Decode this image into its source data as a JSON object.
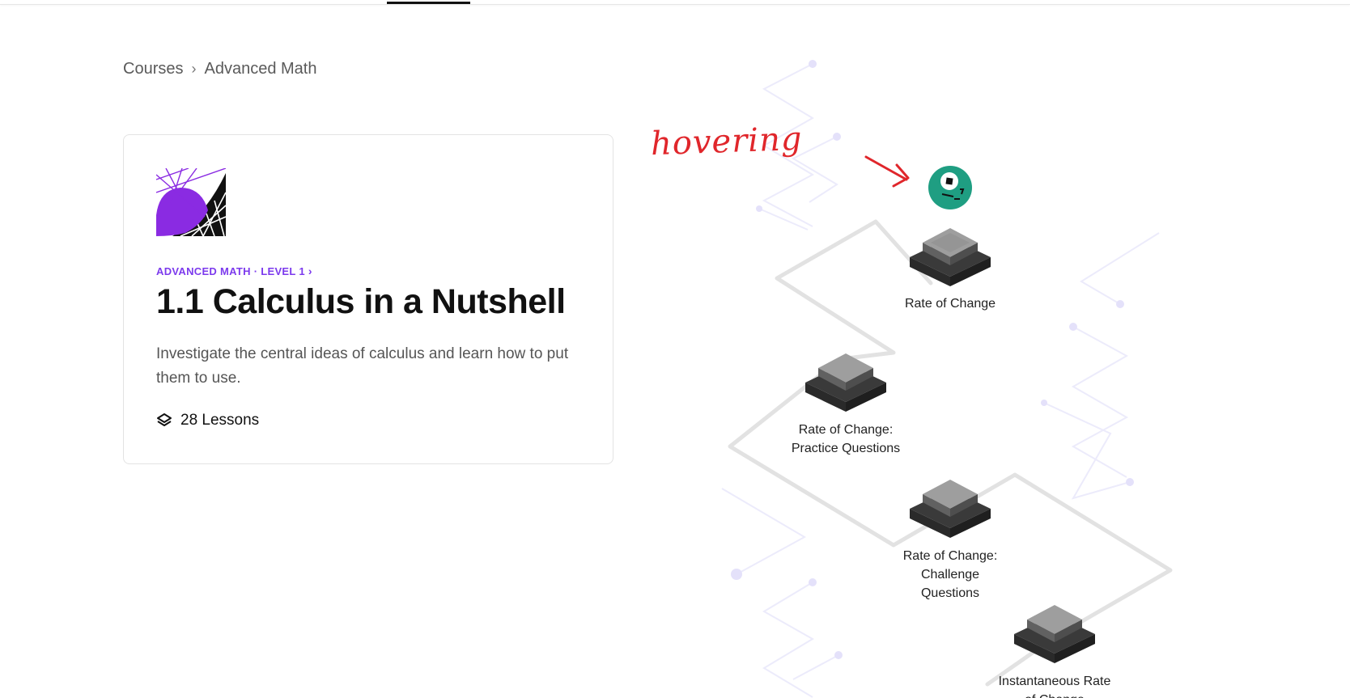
{
  "breadcrumb": {
    "items": [
      "Courses",
      "Advanced Math"
    ],
    "separator": "›"
  },
  "course": {
    "level_label": "ADVANCED MATH · LEVEL 1",
    "level_chevron": "›",
    "title": "1.1 Calculus in a Nutshell",
    "description": "Investigate the central ideas of calculus and learn how to put them to use.",
    "lessons_label": "28 Lessons",
    "icon": "calculus-curve-icon",
    "accent_color": "#7c3aed"
  },
  "path_nodes": [
    {
      "label_lines": [
        "Rate of Change"
      ],
      "state": "hovered"
    },
    {
      "label_lines": [
        "Rate of Change:",
        "Practice Questions"
      ],
      "state": "default"
    },
    {
      "label_lines": [
        "Rate of Change:",
        "Challenge",
        "Questions"
      ],
      "state": "default"
    },
    {
      "label_lines": [
        "Instantaneous Rate",
        "of Change"
      ],
      "state": "default"
    }
  ],
  "annotation": {
    "text": "hovering",
    "color": "#e0262b"
  },
  "avatar": {
    "icon": "robot-avatar-icon",
    "color": "#1f9e82"
  }
}
